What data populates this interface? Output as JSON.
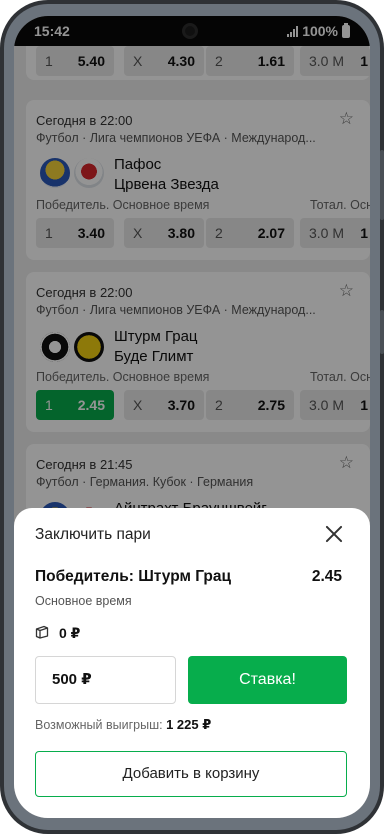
{
  "status_bar": {
    "time": "15:42",
    "battery": "100%"
  },
  "match_top": {
    "odds": [
      {
        "label": "1",
        "value": "5.40"
      },
      {
        "label": "X",
        "value": "4.30"
      },
      {
        "label": "2",
        "value": "1.61"
      },
      {
        "label": "3.0 М",
        "value": "1"
      }
    ]
  },
  "match_1": {
    "time": "Сегодня в 22:00",
    "league": "Футбол · Лига чемпионов УЕФА · Международ...",
    "team_1": "Пафос",
    "team_2": "Црвена Звезда",
    "market": "Победитель. Основное время",
    "market_right": "Тотал. Осно",
    "odds": [
      {
        "label": "1",
        "value": "3.40"
      },
      {
        "label": "X",
        "value": "3.80"
      },
      {
        "label": "2",
        "value": "2.07"
      },
      {
        "label": "3.0 М",
        "value": "1"
      }
    ]
  },
  "match_2": {
    "time": "Сегодня в 22:00",
    "league": "Футбол · Лига чемпионов УЕФА · Международ...",
    "team_1": "Штурм Грац",
    "team_2": "Буде Глимт",
    "market": "Победитель. Основное время",
    "market_right": "Тотал. Осно",
    "odds": [
      {
        "label": "1",
        "value": "2.45"
      },
      {
        "label": "X",
        "value": "3.70"
      },
      {
        "label": "2",
        "value": "2.75"
      },
      {
        "label": "3.0 М",
        "value": "1"
      }
    ]
  },
  "match_3": {
    "time": "Сегодня в 21:45",
    "league": "Футбол · Германия. Кубок · Германия",
    "team_1": "Айнтрахт Брауншвейг"
  },
  "bet_slip": {
    "title": "Заключить пари",
    "selection": "Победитель: Штурм Грац",
    "odds": "2.45",
    "period": "Основное время",
    "coupon_amount": "0 ₽",
    "stake": "500 ₽",
    "bet_button": "Ставка!",
    "payout_label": "Возможный выигрыш:",
    "payout_value": "1 225 ₽",
    "add_to_basket": "Добавить в корзину"
  },
  "colors": {
    "accent": "#07ad4c",
    "overlay": "rgba(0,0,0,0.42)"
  }
}
